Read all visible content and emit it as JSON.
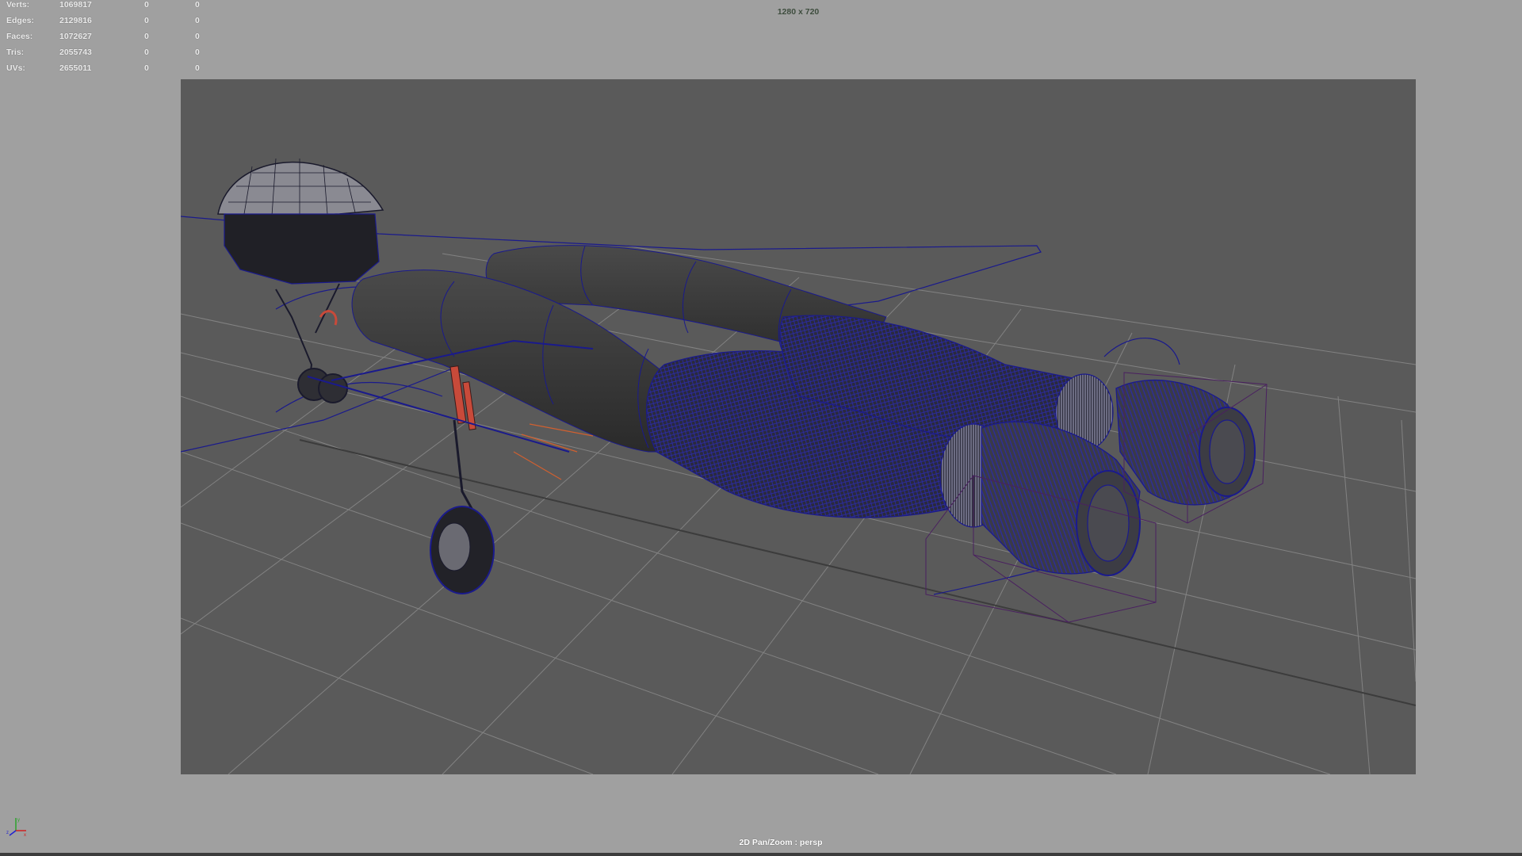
{
  "hud_stats": [
    {
      "label": "Verts:",
      "total": "1069817",
      "selected": "0",
      "selected_sub": "0"
    },
    {
      "label": "Edges:",
      "total": "2129816",
      "selected": "0",
      "selected_sub": "0"
    },
    {
      "label": "Faces:",
      "total": "1072627",
      "selected": "0",
      "selected_sub": "0"
    },
    {
      "label": "Tris:",
      "total": "2055743",
      "selected": "0",
      "selected_sub": "0"
    },
    {
      "label": "UVs:",
      "total": "2655011",
      "selected": "0",
      "selected_sub": "0"
    }
  ],
  "viewport": {
    "resolution_gate": "1280 x 720",
    "status": "2D Pan/Zoom : persp",
    "background_color": "#5a5a5a",
    "grid_color": "#8a8a8a",
    "wireframe_color": "#1a1a8c",
    "highlight_color": "#c84a3a"
  },
  "axis": {
    "x": "x",
    "y": "y",
    "z": "z"
  }
}
